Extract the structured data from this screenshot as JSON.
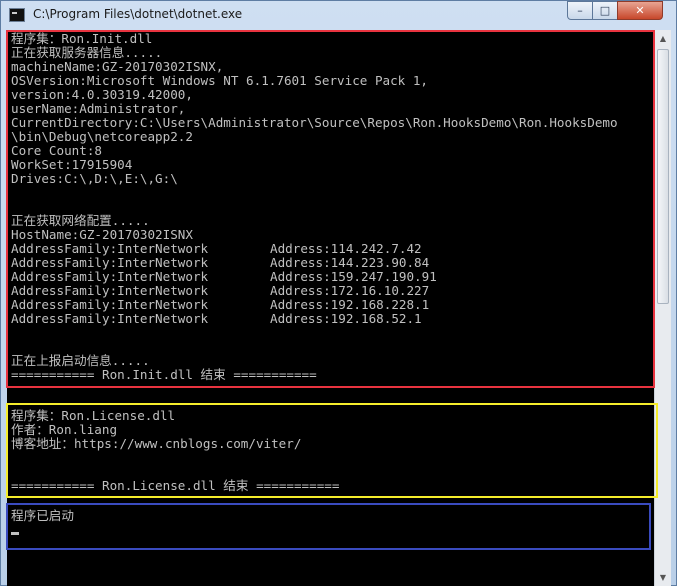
{
  "window": {
    "title": "C:\\Program Files\\dotnet\\dotnet.exe",
    "minimize_glyph": "–",
    "maximize_glyph": "□",
    "close_glyph": "✕"
  },
  "console": {
    "init_section": [
      "程序集：Ron.Init.dll",
      "正在获取服务器信息.....",
      "machineName:GZ-20170302ISNX,",
      "OSVersion:Microsoft Windows NT 6.1.7601 Service Pack 1,",
      "version:4.0.30319.42000,",
      "userName:Administrator,",
      "CurrentDirectory:C:\\Users\\Administrator\\Source\\Repos\\Ron.HooksDemo\\Ron.HooksDemo",
      "\\bin\\Debug\\netcoreapp2.2",
      "Core Count:8",
      "WorkSet:17915904",
      "Drives:C:\\,D:\\,E:\\,G:\\",
      "",
      "",
      "正在获取网络配置.....",
      "HostName:GZ-20170302ISNX"
    ],
    "addresses": [
      {
        "family": "AddressFamily:InterNetwork",
        "address": "Address:114.242.7.42"
      },
      {
        "family": "AddressFamily:InterNetwork",
        "address": "Address:144.223.90.84"
      },
      {
        "family": "AddressFamily:InterNetwork",
        "address": "Address:159.247.190.91"
      },
      {
        "family": "AddressFamily:InterNetwork",
        "address": "Address:172.16.10.227"
      },
      {
        "family": "AddressFamily:InterNetwork",
        "address": "Address:192.168.228.1"
      },
      {
        "family": "AddressFamily:InterNetwork",
        "address": "Address:192.168.52.1"
      }
    ],
    "init_tail": [
      "",
      "",
      "正在上报启动信息.....",
      "=========== Ron.Init.dll 结束 ==========="
    ],
    "license_section": [
      "程序集：Ron.License.dll",
      "作者：Ron.liang",
      "博客地址：https://www.cnblogs.com/viter/",
      "",
      "",
      "=========== Ron.License.dll 结束 ==========="
    ],
    "status_line": "程序已启动"
  }
}
